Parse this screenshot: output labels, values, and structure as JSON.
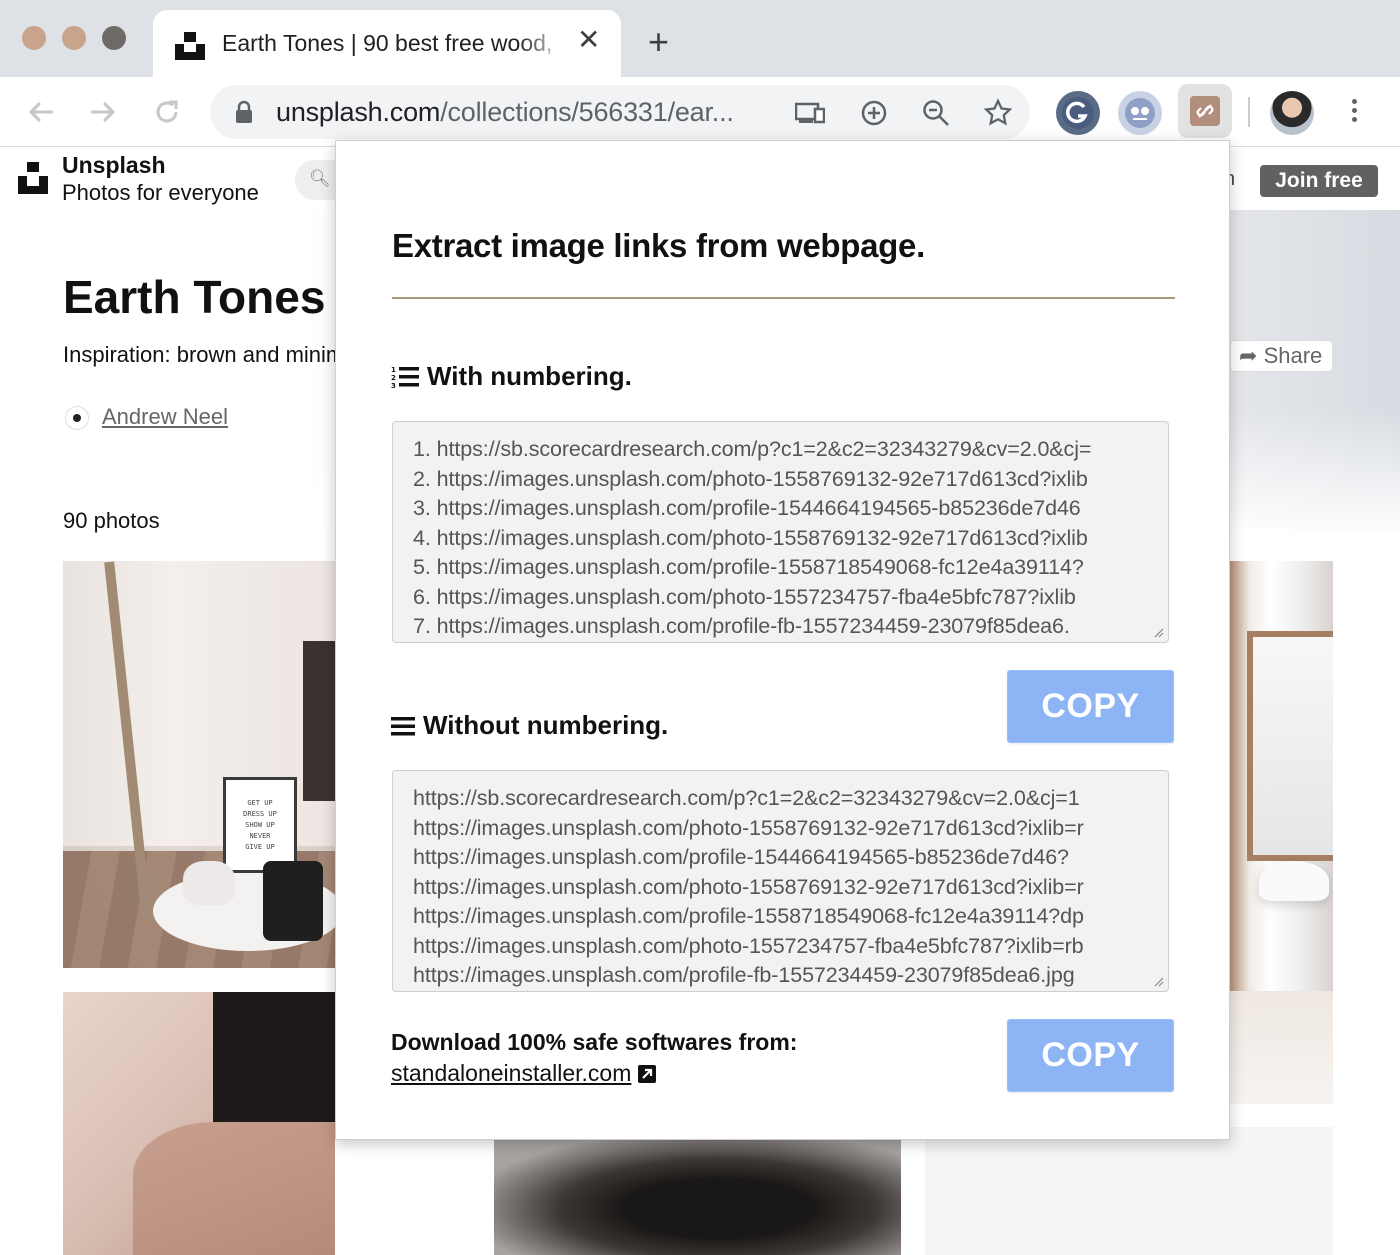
{
  "browser": {
    "tab": {
      "title": "Earth Tones | 90 best free wood,",
      "close_icon": "close-icon"
    },
    "new_tab_label": "+",
    "url": {
      "domain": "unsplash.com",
      "path": "/collections/566331/ear..."
    },
    "icons": [
      "back-arrow-icon",
      "forward-arrow-icon",
      "reload-icon",
      "lock-icon",
      "cast-icon",
      "zoom-in-icon",
      "zoom-out-icon",
      "bookmark-star-icon",
      "grammarly-extension-icon",
      "extension-icon",
      "link-extractor-extension-icon",
      "profile-avatar",
      "more-menu-icon"
    ]
  },
  "site": {
    "brand_name": "Unsplash",
    "brand_tagline": "Photos for everyone",
    "header_partial": "n",
    "join_label": "Join free",
    "collection_title": "Earth Tones",
    "description": "Inspiration: brown and minimal",
    "author": "Andrew Neel",
    "share_label": "Share",
    "photo_count": "90 photos",
    "sign_text": [
      "GET UP",
      "DRESS UP",
      "SHOW UP",
      "NEVER",
      "GIVE UP"
    ]
  },
  "popup": {
    "title": "Extract image links from webpage.",
    "with_numbering_label": "With numbering.",
    "without_numbering_label": "Without numbering.",
    "numbered_links": [
      "1. https://sb.scorecardresearch.com/p?c1=2&c2=32343279&cv=2.0&cj=",
      "2. https://images.unsplash.com/photo-1558769132-92e717d613cd?ixlib",
      "3. https://images.unsplash.com/profile-1544664194565-b85236de7d46",
      "4. https://images.unsplash.com/photo-1558769132-92e717d613cd?ixlib",
      "5. https://images.unsplash.com/profile-1558718549068-fc12e4a39114?",
      "6. https://images.unsplash.com/photo-1557234757-fba4e5bfc787?ixlib",
      "7. https://images.unsplash.com/profile-fb-1557234459-23079f85dea6."
    ],
    "plain_links": [
      "https://sb.scorecardresearch.com/p?c1=2&c2=32343279&cv=2.0&cj=1",
      "https://images.unsplash.com/photo-1558769132-92e717d613cd?ixlib=r",
      "https://images.unsplash.com/profile-1544664194565-b85236de7d46?",
      "https://images.unsplash.com/photo-1558769132-92e717d613cd?ixlib=r",
      "https://images.unsplash.com/profile-1558718549068-fc12e4a39114?dp",
      "https://images.unsplash.com/photo-1557234757-fba4e5bfc787?ixlib=rb",
      "https://images.unsplash.com/profile-fb-1557234459-23079f85dea6.jpg"
    ],
    "copy_label": "COPY",
    "footer_text": "Download 100% safe softwares from:",
    "footer_link": "standaloneinstaller.com"
  },
  "colors": {
    "copy_button": "#8db4f5",
    "tabstrip": "#dee1e6",
    "join_button": "#616161",
    "rule": "#a89880"
  }
}
